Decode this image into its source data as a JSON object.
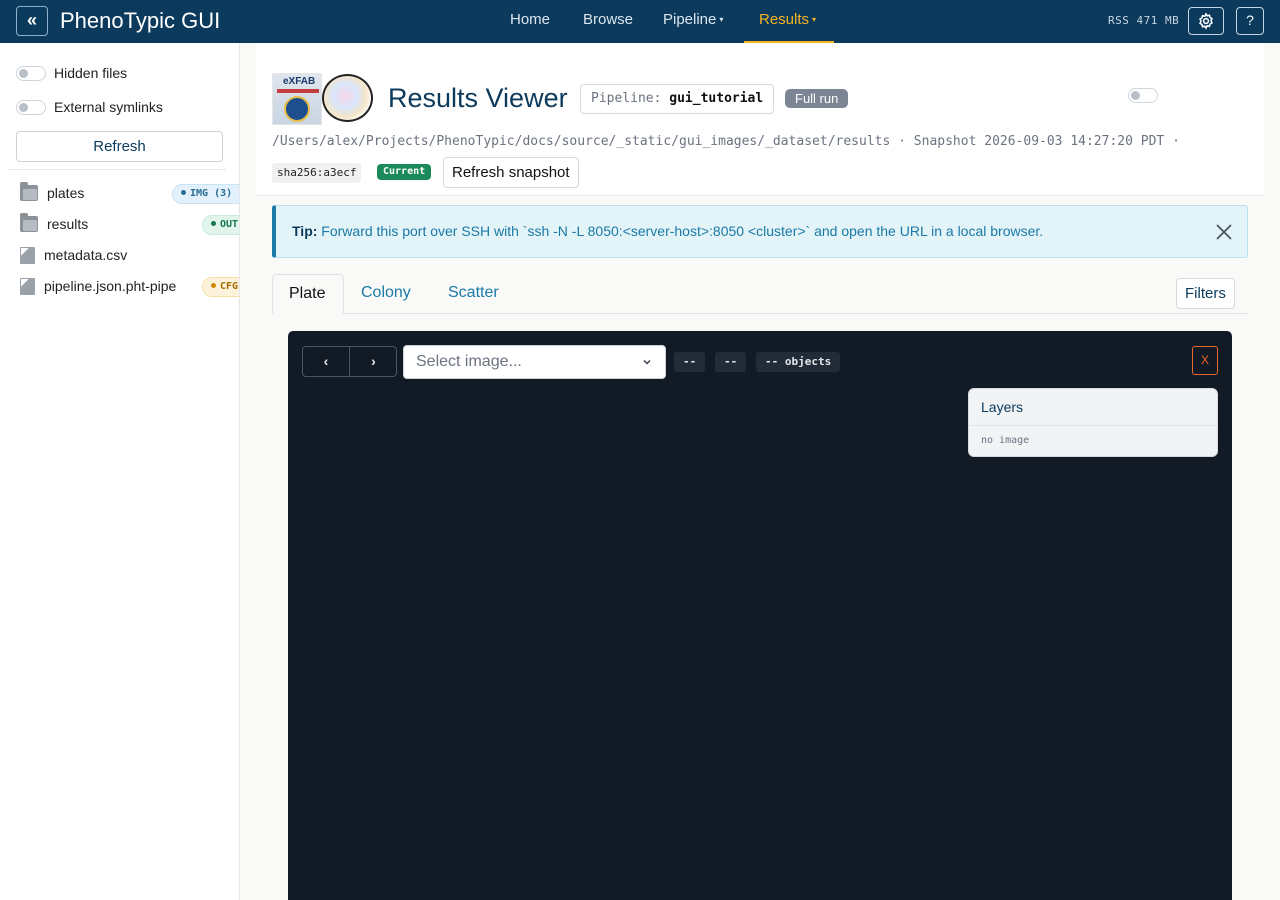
{
  "navbar": {
    "collapse_glyph": "«",
    "brand": "PhenoTypic GUI",
    "links": [
      {
        "label": "Home"
      },
      {
        "label": "Browse"
      },
      {
        "label": "Pipeline",
        "caret": "▾"
      },
      {
        "label": "Results",
        "caret": "▾",
        "active": true
      }
    ],
    "rss": "RSS 471 MB",
    "help_glyph": "?"
  },
  "sidebar": {
    "toggles": [
      {
        "label": "Hidden files",
        "on": false
      },
      {
        "label": "External symlinks",
        "on": false
      }
    ],
    "refresh_label": "Refresh",
    "items": [
      {
        "label": "plates",
        "type": "folder",
        "badge": "IMG (3)",
        "badge_kind": "img"
      },
      {
        "label": "results",
        "type": "folder",
        "badge": "OUT",
        "badge_kind": "out"
      },
      {
        "label": "metadata.csv",
        "type": "file"
      },
      {
        "label": "pipeline.json.pht-pipe",
        "type": "file",
        "badge": "CFG",
        "badge_kind": "cfg"
      }
    ]
  },
  "header": {
    "logo1_text": "eXFAB",
    "title": "Results Viewer",
    "pipeline_key": "Pipeline:",
    "pipeline_value": "gui_tutorial",
    "run_badge": "Full run",
    "path": "/Users/alex/Projects/PhenoTypic/docs/source/_static/gui_images/_dataset/results",
    "snapshot": "Snapshot 2026-09-03 14:27:20 PDT",
    "separator": "·",
    "sha": "sha256:a3ecf",
    "current_badge": "Current",
    "refresh_snapshot_label": "Refresh snapshot"
  },
  "tip": {
    "label": "Tip:",
    "text": "Forward this port over SSH with `ssh -N -L 8050:<server-host>:8050 <cluster>` and open the URL in a local browser."
  },
  "tabs": [
    {
      "label": "Plate",
      "active": true
    },
    {
      "label": "Colony"
    },
    {
      "label": "Scatter"
    }
  ],
  "filters_label": "Filters",
  "viewer": {
    "prev_glyph": "‹",
    "next_glyph": "›",
    "select_placeholder": "Select image...",
    "chip1": "--",
    "chip2": "--",
    "chip3": "-- objects",
    "close_label": "X",
    "layers_title": "Layers",
    "layers_empty": "no image"
  },
  "colors": {
    "navbar_bg": "#0b3a5c",
    "active_accent": "#f5b324",
    "link": "#1a79a8",
    "viewer_bg": "#121a26",
    "close_accent": "#e8672a",
    "current_green": "#1b8a5a"
  },
  "icons": {
    "settings": "gear-icon",
    "close_tip": "close-icon",
    "folder": "folder-icon",
    "file": "file-icon",
    "chevron": "chevron-down-icon"
  }
}
